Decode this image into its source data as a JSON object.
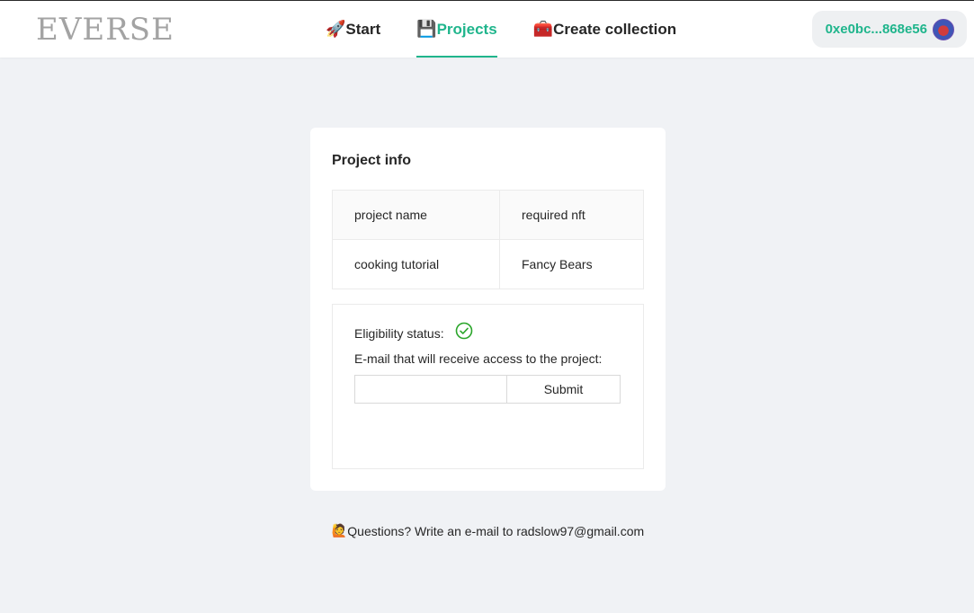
{
  "header": {
    "logo": "EVERSE",
    "nav": [
      {
        "emoji": "🚀",
        "label": "Start"
      },
      {
        "emoji": "💾",
        "label": "Projects"
      },
      {
        "emoji": "🧰",
        "label": "Create collection"
      }
    ],
    "active_tab": "Projects",
    "wallet_address": "0xe0bc...868e56"
  },
  "card": {
    "title": "Project info",
    "table": {
      "headers": [
        "project name",
        "required nft"
      ],
      "rows": [
        [
          "cooking tutorial",
          "Fancy Bears"
        ]
      ]
    },
    "eligibility_label": "Eligibility status:",
    "eligibility_icon": "check-circle-icon",
    "email_label": "E-mail that will receive access to the project:",
    "email_value": "",
    "submit_label": "Submit"
  },
  "footer": {
    "emoji": "🙋",
    "text": "Questions? Write an e-mail to radslow97@gmail.com"
  },
  "colors": {
    "accent": "#1fb58c",
    "background": "#f0f2f5",
    "check": "#2aa52a"
  }
}
